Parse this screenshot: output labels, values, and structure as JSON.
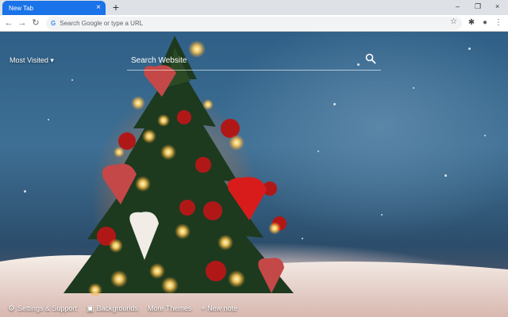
{
  "tab": {
    "title": "New Tab",
    "close": "×",
    "new_tab": "+"
  },
  "window_controls": {
    "minimize": "–",
    "restore": "❐",
    "close": "×"
  },
  "toolbar": {
    "back": "←",
    "forward": "→",
    "reload": "↻",
    "omnibox_placeholder": "Search Google or type a URL",
    "g_icon": "G",
    "star": "☆",
    "extensions": "✱",
    "profile": "●",
    "menu": "⋮"
  },
  "page": {
    "most_visited": "Most Visited ▾",
    "search_placeholder": "Search Website",
    "bottom": {
      "settings": "Settings & Support",
      "backgrounds": "Backgrounds",
      "more_themes": "More Themes",
      "new_note": "+ New note"
    }
  },
  "icons": {
    "settings": "gear-icon",
    "backgrounds": "images-icon",
    "search": "magnifier-icon"
  }
}
